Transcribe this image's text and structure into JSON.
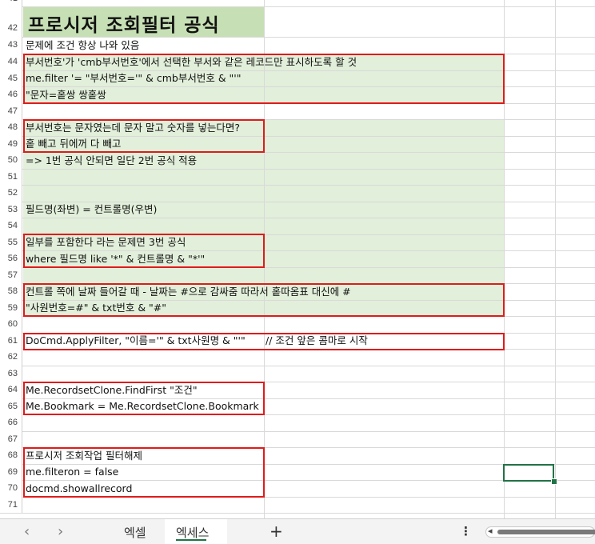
{
  "sheet": {
    "row_numbers": [
      "41",
      "42",
      "43",
      "44",
      "45",
      "46",
      "47",
      "48",
      "49",
      "50",
      "51",
      "52",
      "53",
      "54",
      "55",
      "56",
      "57",
      "58",
      "59",
      "60",
      "61",
      "62",
      "63",
      "64",
      "65",
      "66",
      "67",
      "68",
      "69",
      "70",
      "71"
    ],
    "title": "프로시저 조회필터 공식",
    "lines": {
      "r43": "문제에 조건 항상 나와 있음",
      "r44": "부서번호'가 'cmb부서번호'에서 선택한 부서와 같은 레코드만 표시하도록 할 것",
      "r45": "me.filter '= \"부서번호='\" & cmb부서번호 & \"'\"",
      "r46": "\"문자=홑쌍 쌍홑쌍",
      "r48": "부서번호는 문자였는데 문자 말고 숫자를 넣는다면?",
      "r49": "홑 빼고 뒤에꺼 다 빼고",
      "r50": "=> 1번 공식 안되면 일단 2번 공식 적용",
      "r53": "필드명(좌변) = 컨트롤명(우변)",
      "r55": "일부를 포함한다 라는 문제면 3번 공식",
      "r56": "where 필드명 like '*\" & 컨트롤명 & \"*'\"",
      "r58": "컨트롤 쪽에 날짜 들어갈 때 - 날짜는 #으로 감싸줌 따라서 홑따옴표 대신에 #",
      "r59": "\"사원번호=#\" & txt번호 & \"#\"",
      "r61": "DoCmd.ApplyFilter, \"이름='\" & txt사원명 & \"'\"",
      "r61_comment": "// 조건 앞은 콤마로 시작",
      "r64": "Me.RecordsetClone.FindFirst \"조건\"",
      "r65": "Me.Bookmark = Me.RecordsetClone.Bookmark",
      "r68": "프로시저 조회작업 필터해제",
      "r69": "me.filteron = false",
      "r70": "docmd.showallrecord"
    }
  },
  "tabs": {
    "prev": "‹",
    "next": "›",
    "sheet1": "엑셀",
    "sheet2": "엑세스",
    "add": "+",
    "more": "⋮",
    "scroll_left": "◂"
  },
  "colors": {
    "highlight": "#e2efda",
    "title_fill": "#c6dfb4",
    "box_border": "#e01b1b",
    "selection": "#217346"
  }
}
